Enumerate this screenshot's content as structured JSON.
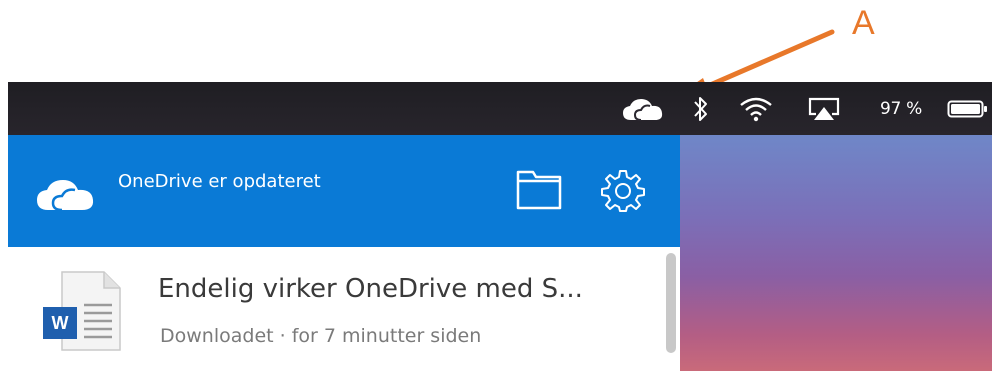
{
  "annotation": {
    "label": "A",
    "color": "#e8782a"
  },
  "menubar": {
    "icons": [
      "onedrive-cloud-icon",
      "bluetooth-icon",
      "wifi-icon",
      "airplay-icon",
      "battery-icon"
    ],
    "battery_percent": "97 %"
  },
  "onedrive": {
    "header_color": "#0a7ad6",
    "status_title": "OneDrive er opdateret",
    "items": [
      {
        "title": "Endelig virker OneDrive med S...",
        "status": "Downloadet · for 7 minutter siden",
        "file_icon": "word-document-icon"
      }
    ]
  }
}
